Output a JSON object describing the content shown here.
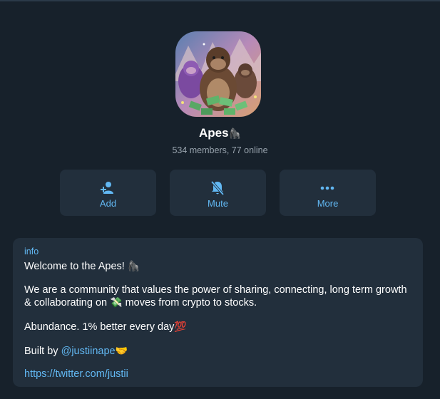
{
  "group": {
    "name": "Apes",
    "name_emoji": "🦍",
    "stats": "534 members, 77 online"
  },
  "actions": [
    {
      "label": "Add",
      "icon": "add-user-icon"
    },
    {
      "label": "Mute",
      "icon": "bell-mute-icon"
    },
    {
      "label": "More",
      "icon": "more-dots-icon"
    }
  ],
  "info": {
    "label": "info",
    "welcome": "Welcome to the Apes! ",
    "welcome_emoji": "🦍",
    "desc_part1": "We are a community that values the power of sharing, connecting, long term growth & collaborating on ",
    "desc_emoji": "💸",
    "desc_part2": " moves from crypto to stocks.",
    "abundance": "Abundance. 1% better every day",
    "abundance_emoji": "💯",
    "built_by_prefix": "Built by ",
    "built_by_handle": "@justiinape",
    "built_by_emoji": "🤝",
    "link": "https://twitter.com/justii"
  },
  "colors": {
    "background": "#17212b",
    "card": "#222f3c",
    "accent": "#62b8f3",
    "muted_text": "#98a3ad"
  }
}
